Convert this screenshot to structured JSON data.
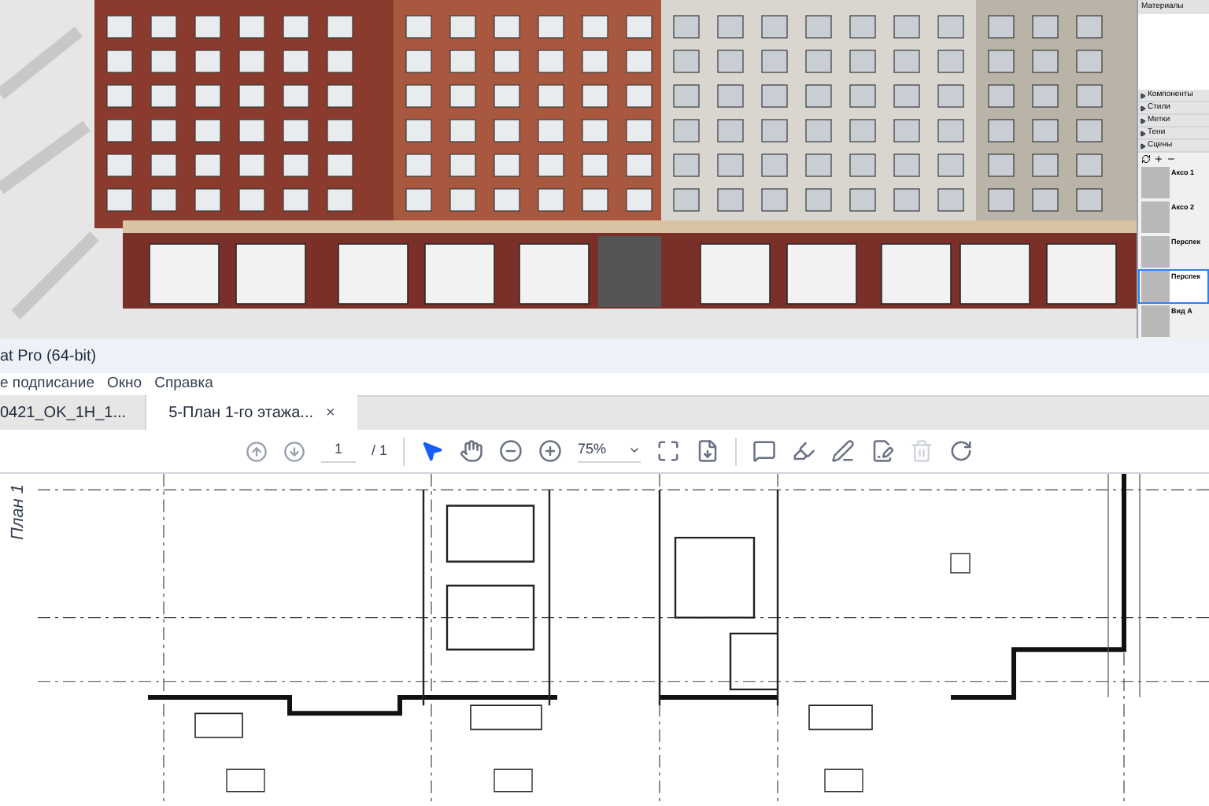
{
  "model_window": {
    "tray_title": "Материалы",
    "tray_sections": [
      "Компоненты",
      "Стили",
      "Метки",
      "Тени",
      "Сцены"
    ],
    "scenes": [
      {
        "name": "Аксо 1",
        "selected": false
      },
      {
        "name": "Аксо 2",
        "selected": false
      },
      {
        "name": "Перспек",
        "selected": false
      },
      {
        "name": "Перспек",
        "selected": true
      },
      {
        "name": "Вид А",
        "selected": false
      }
    ]
  },
  "acrobat": {
    "title": "at Pro (64-bit)",
    "menu": [
      "е подписание",
      "Окно",
      "Справка"
    ],
    "tabs": [
      {
        "label": "0421_OK_1H_1...",
        "selected": false
      },
      {
        "label": "5-План 1-го этажа...",
        "selected": true,
        "close": "×"
      }
    ],
    "toolbar": {
      "page": "1",
      "page_total": "/ 1",
      "zoom": "75%"
    }
  },
  "document": {
    "side_label": "План 1"
  }
}
